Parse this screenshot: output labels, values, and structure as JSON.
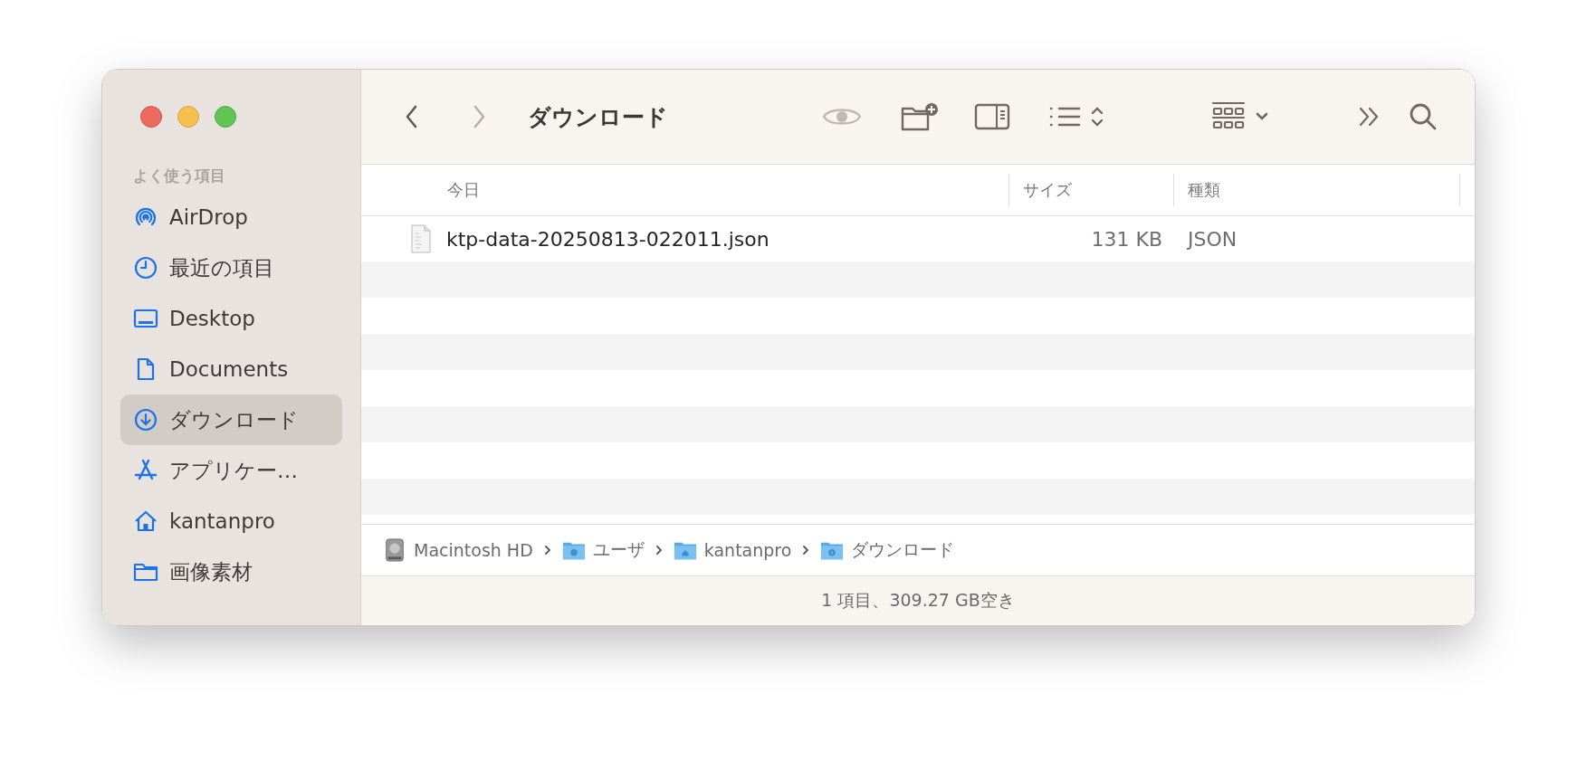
{
  "window": {
    "title": "ダウンロード"
  },
  "toolbar": {
    "back": {
      "disabled": false
    },
    "forward": {
      "disabled": true
    },
    "quick_look": {
      "disabled": true
    }
  },
  "sidebar": {
    "section": "よく使う項目",
    "items": [
      {
        "label": "AirDrop",
        "kind": "airdrop",
        "selected": false
      },
      {
        "label": "最近の項目",
        "kind": "clock",
        "selected": false
      },
      {
        "label": "Desktop",
        "kind": "desktop",
        "selected": false
      },
      {
        "label": "Documents",
        "kind": "document",
        "selected": false
      },
      {
        "label": "ダウンロード",
        "kind": "download",
        "selected": true
      },
      {
        "label": "アプリケー…",
        "kind": "apps",
        "selected": false
      },
      {
        "label": "kantanpro",
        "kind": "home",
        "selected": false
      },
      {
        "label": "画像素材",
        "kind": "folder",
        "selected": false
      }
    ]
  },
  "table": {
    "columns": [
      "今日",
      "サイズ",
      "種類"
    ],
    "rows": [
      {
        "name": "ktp-data-20250813-022011.json",
        "size": "131 KB",
        "kind": "JSON"
      }
    ]
  },
  "path_bar": [
    {
      "label": "Macintosh HD",
      "kind": "disk"
    },
    {
      "label": "ユーザ",
      "kind": "users"
    },
    {
      "label": "kantanpro",
      "kind": "home"
    },
    {
      "label": "ダウンロード",
      "kind": "downloads"
    }
  ],
  "status_bar": "1 項目、309.27 GB空き"
}
